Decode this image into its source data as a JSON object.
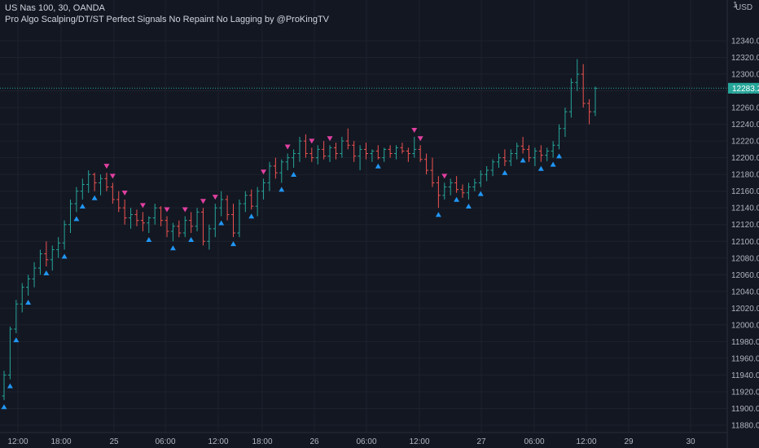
{
  "header": {
    "symbol_line": "US Nas 100, 30, OANDA",
    "indicator_line": "Pro Algo Scalping/DT/ST Perfect Signals No Repaint No Lagging by @ProKingTV"
  },
  "price_axis": {
    "currency": "USD",
    "top_partial_label": "1",
    "ticks": [
      "12340.0",
      "12320.0",
      "12300.0",
      "12280.0",
      "12260.0",
      "12240.0",
      "12220.0",
      "12200.0",
      "12180.0",
      "12160.0",
      "12140.0",
      "12120.0",
      "12100.0",
      "12080.0",
      "12060.0",
      "12040.0",
      "12020.0",
      "12000.0",
      "11980.0",
      "11960.0",
      "11940.0",
      "11920.0",
      "11900.0",
      "11880.0"
    ],
    "current_price_label": "12283.2"
  },
  "time_axis": {
    "ticks": [
      "12:00",
      "18:00",
      "25",
      "06:00",
      "12:00",
      "18:00",
      "26",
      "06:00",
      "12:00",
      "27",
      "06:00",
      "12:00",
      "29",
      "30"
    ]
  },
  "colors": {
    "background": "#131722",
    "up": "#26a69a",
    "down": "#ef5350",
    "buy_signal": "#2196f3",
    "sell_signal": "#e040a0",
    "grid": "#1e222d",
    "price_line": "#26a69a"
  },
  "chart_data": {
    "type": "ohlc",
    "ylim": [
      11875,
      12350
    ],
    "current_price": 12283.2,
    "bars": [
      [
        11915,
        11945,
        11910,
        11940
      ],
      [
        11940,
        11998,
        11935,
        11995
      ],
      [
        11995,
        12030,
        11990,
        12025
      ],
      [
        12025,
        12050,
        12015,
        12045
      ],
      [
        12045,
        12060,
        12035,
        12055
      ],
      [
        12055,
        12075,
        12045,
        12068
      ],
      [
        12068,
        12090,
        12060,
        12085
      ],
      [
        12085,
        12100,
        12070,
        12078
      ],
      [
        12078,
        12095,
        12065,
        12090
      ],
      [
        12090,
        12105,
        12080,
        12098
      ],
      [
        12098,
        12125,
        12090,
        12120
      ],
      [
        12120,
        12150,
        12110,
        12145
      ],
      [
        12145,
        12165,
        12135,
        12160
      ],
      [
        12160,
        12175,
        12150,
        12168
      ],
      [
        12168,
        12185,
        12158,
        12180
      ],
      [
        12180,
        12182,
        12160,
        12170
      ],
      [
        12170,
        12180,
        12155,
        12175
      ],
      [
        12175,
        12182,
        12160,
        12165
      ],
      [
        12165,
        12170,
        12145,
        12150
      ],
      [
        12150,
        12160,
        12135,
        12140
      ],
      [
        12140,
        12150,
        12120,
        12128
      ],
      [
        12128,
        12140,
        12115,
        12132
      ],
      [
        12132,
        12138,
        12118,
        12125
      ],
      [
        12125,
        12135,
        12112,
        12122
      ],
      [
        12122,
        12130,
        12110,
        12128
      ],
      [
        12128,
        12145,
        12120,
        12140
      ],
      [
        12140,
        12142,
        12118,
        12125
      ],
      [
        12125,
        12130,
        12105,
        12112
      ],
      [
        12112,
        12122,
        12100,
        12118
      ],
      [
        12118,
        12125,
        12105,
        12110
      ],
      [
        12110,
        12130,
        12105,
        12125
      ],
      [
        12125,
        12135,
        12110,
        12118
      ],
      [
        12118,
        12140,
        12112,
        12135
      ],
      [
        12135,
        12140,
        12095,
        12100
      ],
      [
        12100,
        12120,
        12090,
        12115
      ],
      [
        12115,
        12145,
        12105,
        12140
      ],
      [
        12140,
        12160,
        12130,
        12150
      ],
      [
        12150,
        12155,
        12125,
        12132
      ],
      [
        12132,
        12145,
        12105,
        12110
      ],
      [
        12110,
        12150,
        12105,
        12145
      ],
      [
        12145,
        12160,
        12135,
        12155
      ],
      [
        12155,
        12162,
        12138,
        12142
      ],
      [
        12142,
        12165,
        12130,
        12160
      ],
      [
        12160,
        12175,
        12150,
        12170
      ],
      [
        12170,
        12195,
        12160,
        12190
      ],
      [
        12190,
        12200,
        12175,
        12182
      ],
      [
        12182,
        12198,
        12170,
        12195
      ],
      [
        12195,
        12205,
        12185,
        12200
      ],
      [
        12200,
        12210,
        12188,
        12205
      ],
      [
        12205,
        12225,
        12195,
        12220
      ],
      [
        12220,
        12228,
        12200,
        12205
      ],
      [
        12205,
        12212,
        12195,
        12200
      ],
      [
        12200,
        12215,
        12192,
        12210
      ],
      [
        12210,
        12220,
        12198,
        12202
      ],
      [
        12202,
        12215,
        12195,
        12212
      ],
      [
        12212,
        12218,
        12198,
        12205
      ],
      [
        12205,
        12225,
        12200,
        12220
      ],
      [
        12220,
        12235,
        12210,
        12215
      ],
      [
        12215,
        12220,
        12195,
        12202
      ],
      [
        12202,
        12215,
        12185,
        12210
      ],
      [
        12210,
        12218,
        12198,
        12205
      ],
      [
        12205,
        12210,
        12195,
        12208
      ],
      [
        12208,
        12215,
        12198,
        12200
      ],
      [
        12200,
        12212,
        12195,
        12210
      ],
      [
        12210,
        12215,
        12200,
        12205
      ],
      [
        12205,
        12215,
        12198,
        12212
      ],
      [
        12212,
        12218,
        12205,
        12208
      ],
      [
        12208,
        12212,
        12195,
        12205
      ],
      [
        12205,
        12225,
        12200,
        12210
      ],
      [
        12210,
        12215,
        12195,
        12198
      ],
      [
        12198,
        12205,
        12180,
        12185
      ],
      [
        12185,
        12200,
        12165,
        12170
      ],
      [
        12170,
        12178,
        12140,
        12155
      ],
      [
        12155,
        12170,
        12150,
        12165
      ],
      [
        12165,
        12175,
        12155,
        12170
      ],
      [
        12170,
        12178,
        12158,
        12162
      ],
      [
        12162,
        12168,
        12152,
        12158
      ],
      [
        12158,
        12170,
        12150,
        12165
      ],
      [
        12165,
        12175,
        12160,
        12170
      ],
      [
        12170,
        12185,
        12165,
        12180
      ],
      [
        12180,
        12190,
        12172,
        12185
      ],
      [
        12185,
        12198,
        12178,
        12195
      ],
      [
        12195,
        12205,
        12188,
        12200
      ],
      [
        12200,
        12210,
        12190,
        12196
      ],
      [
        12196,
        12210,
        12190,
        12205
      ],
      [
        12205,
        12218,
        12198,
        12214
      ],
      [
        12214,
        12225,
        12205,
        12210
      ],
      [
        12210,
        12215,
        12195,
        12200
      ],
      [
        12200,
        12212,
        12190,
        12208
      ],
      [
        12208,
        12215,
        12195,
        12203
      ],
      [
        12203,
        12212,
        12196,
        12208
      ],
      [
        12208,
        12220,
        12200,
        12215
      ],
      [
        12215,
        12240,
        12210,
        12235
      ],
      [
        12235,
        12260,
        12225,
        12255
      ],
      [
        12255,
        12295,
        12248,
        12290
      ],
      [
        12290,
        12318,
        12280,
        12300
      ],
      [
        12300,
        12312,
        12260,
        12265
      ],
      [
        12265,
        12270,
        12240,
        12255
      ],
      [
        12255,
        12285,
        12250,
        12283
      ]
    ],
    "buy_signals_at_bar": [
      0,
      1,
      2,
      4,
      7,
      10,
      12,
      13,
      15,
      24,
      28,
      31,
      36,
      38,
      41,
      46,
      48,
      62,
      72,
      75,
      77,
      79,
      83,
      86,
      89,
      91,
      92
    ],
    "sell_signals_at_bar": [
      17,
      18,
      20,
      23,
      27,
      30,
      33,
      35,
      43,
      47,
      51,
      54,
      68,
      69,
      73
    ]
  }
}
